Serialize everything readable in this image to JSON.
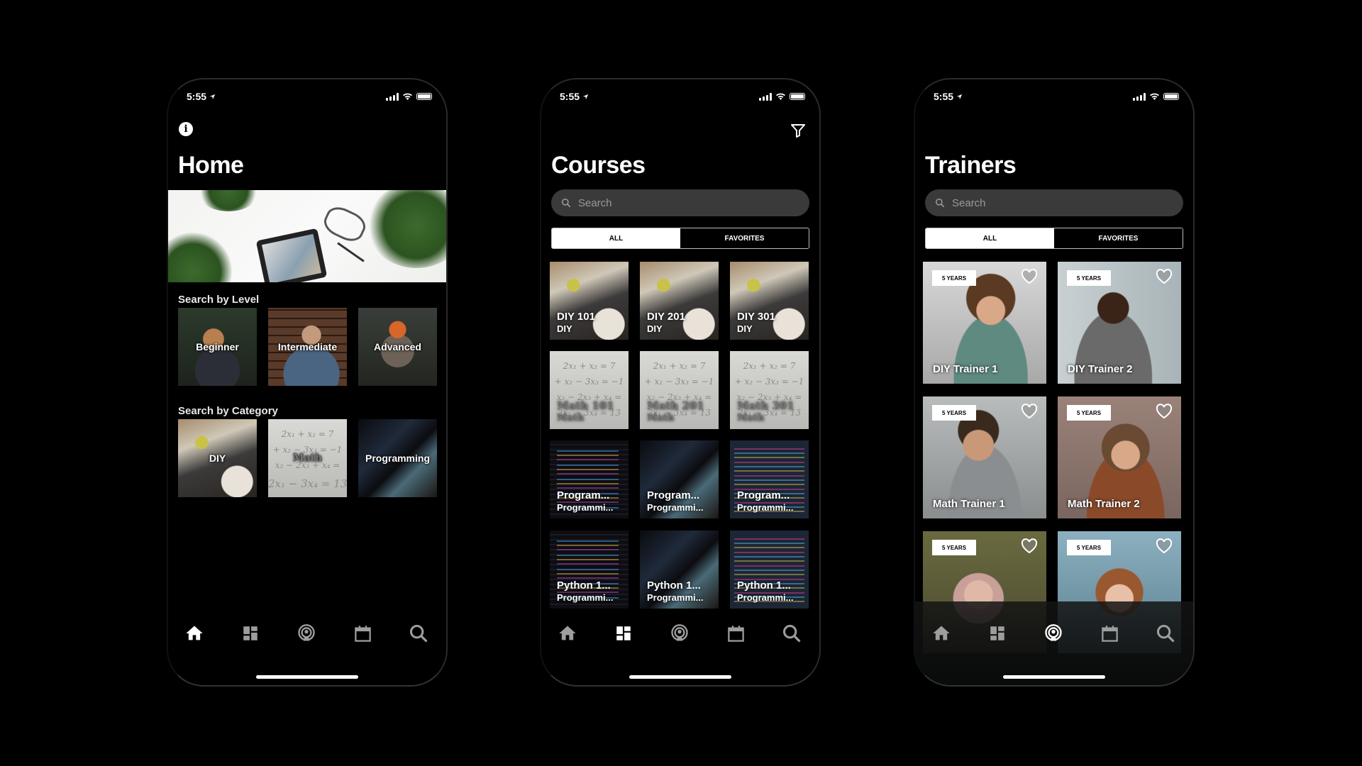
{
  "status_bar": {
    "time": "5:55"
  },
  "home": {
    "title": "Home",
    "level_label": "Search by Level",
    "levels": [
      {
        "label": "Beginner"
      },
      {
        "label": "Intermediate"
      },
      {
        "label": "Advanced"
      }
    ],
    "category_label": "Search by Category",
    "categories": [
      {
        "label": "DIY"
      },
      {
        "label": "Math"
      },
      {
        "label": "Programming"
      }
    ],
    "active_tab": "home"
  },
  "courses": {
    "title": "Courses",
    "search_placeholder": "Search",
    "segments": [
      "ALL",
      "FAVORITES"
    ],
    "selected_segment": "ALL",
    "items": [
      {
        "title": "DIY 101",
        "category": "DIY"
      },
      {
        "title": "DIY 201",
        "category": "DIY"
      },
      {
        "title": "DIY 301",
        "category": "DIY"
      },
      {
        "title": "Math 101",
        "category": "Math"
      },
      {
        "title": "Math 201",
        "category": "Math"
      },
      {
        "title": "Math 301",
        "category": "Math"
      },
      {
        "title": "Program...",
        "category": "Programmi..."
      },
      {
        "title": "Program...",
        "category": "Programmi..."
      },
      {
        "title": "Program...",
        "category": "Programmi..."
      },
      {
        "title": "Python 1...",
        "category": "Programmi..."
      },
      {
        "title": "Python 1...",
        "category": "Programmi..."
      },
      {
        "title": "Python 1...",
        "category": "Programmi..."
      }
    ],
    "active_tab": "courses"
  },
  "trainers": {
    "title": "Trainers",
    "search_placeholder": "Search",
    "segments": [
      "ALL",
      "FAVORITES"
    ],
    "selected_segment": "ALL",
    "items": [
      {
        "name": "DIY Trainer 1",
        "experience": "5 YEARS"
      },
      {
        "name": "DIY Trainer 2",
        "experience": "5 YEARS"
      },
      {
        "name": "Math Trainer 1",
        "experience": "5 YEARS"
      },
      {
        "name": "Math Trainer 2",
        "experience": "5 YEARS"
      },
      {
        "name": "",
        "experience": "5 YEARS"
      },
      {
        "name": "",
        "experience": "5 YEARS"
      }
    ],
    "active_tab": "trainers"
  },
  "tabbar": {
    "tabs": [
      {
        "id": "home",
        "icon": "home-icon"
      },
      {
        "id": "courses",
        "icon": "dashboard-icon"
      },
      {
        "id": "trainers",
        "icon": "podcast-icon"
      },
      {
        "id": "calendar",
        "icon": "calendar-icon"
      },
      {
        "id": "search",
        "icon": "search-icon"
      }
    ],
    "active_color": "#ffffff",
    "inactive_color": "#9e9e9e"
  }
}
